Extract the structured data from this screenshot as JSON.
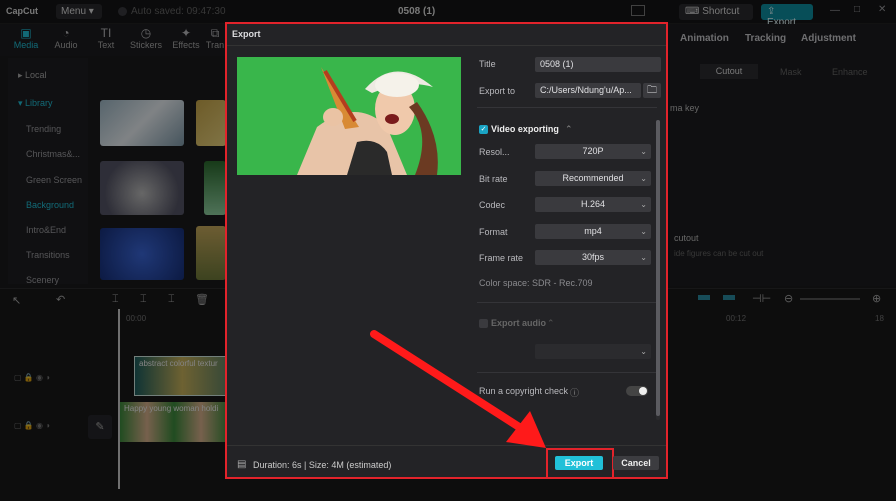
{
  "topbar": {
    "app_name": "CapCut",
    "menu_label": "Menu",
    "autosave": "Auto saved: 09:47:30",
    "project_name": "0508 (1)",
    "shortcut_label": "Shortcut",
    "export_label": "Export"
  },
  "toolbar": {
    "tools": [
      "Media",
      "Audio",
      "Text",
      "Stickers",
      "Effects",
      "Tran"
    ]
  },
  "sidebar": {
    "items": [
      "Local",
      "Library",
      "Trending",
      "Christmas&...",
      "Green Screen",
      "Background",
      "Intro&End",
      "Transitions",
      "Scenery"
    ]
  },
  "right_panel": {
    "tabs": [
      "Animation",
      "Tracking",
      "Adjustment"
    ],
    "subtabs": [
      "Cutout",
      "Mask",
      "Enhance"
    ],
    "chroma_key": "ma key",
    "cutout_label": "cutout",
    "cutout_hint": "ide figures can be cut out"
  },
  "timeline": {
    "time_start": "00:00",
    "time_mark": "00:12",
    "time_end": "18",
    "clip1": "abstract colorful textur",
    "clip2": "Happy young woman holdi"
  },
  "dialog": {
    "title": "Export",
    "title_label": "Title",
    "title_value": "0508 (1)",
    "export_to_label": "Export to",
    "export_to_value": "C:/Users/Ndung'u/Ap...",
    "video_section": "Video exporting",
    "resolution_label": "Resol...",
    "resolution_value": "720P",
    "bitrate_label": "Bit rate",
    "bitrate_value": "Recommended",
    "codec_label": "Codec",
    "codec_value": "H.264",
    "format_label": "Format",
    "format_value": "mp4",
    "framerate_label": "Frame rate",
    "framerate_value": "30fps",
    "color_space": "Color space: SDR - Rec.709",
    "audio_section": "Export audio",
    "copyright_label": "Run a copyright check",
    "footer_info": "Duration: 6s | Size: 4M (estimated)",
    "export_button": "Export",
    "cancel_button": "Cancel"
  },
  "colors": {
    "accent": "#21c0d8",
    "highlight": "#e2232b",
    "preview_bg": "#38b54a"
  }
}
